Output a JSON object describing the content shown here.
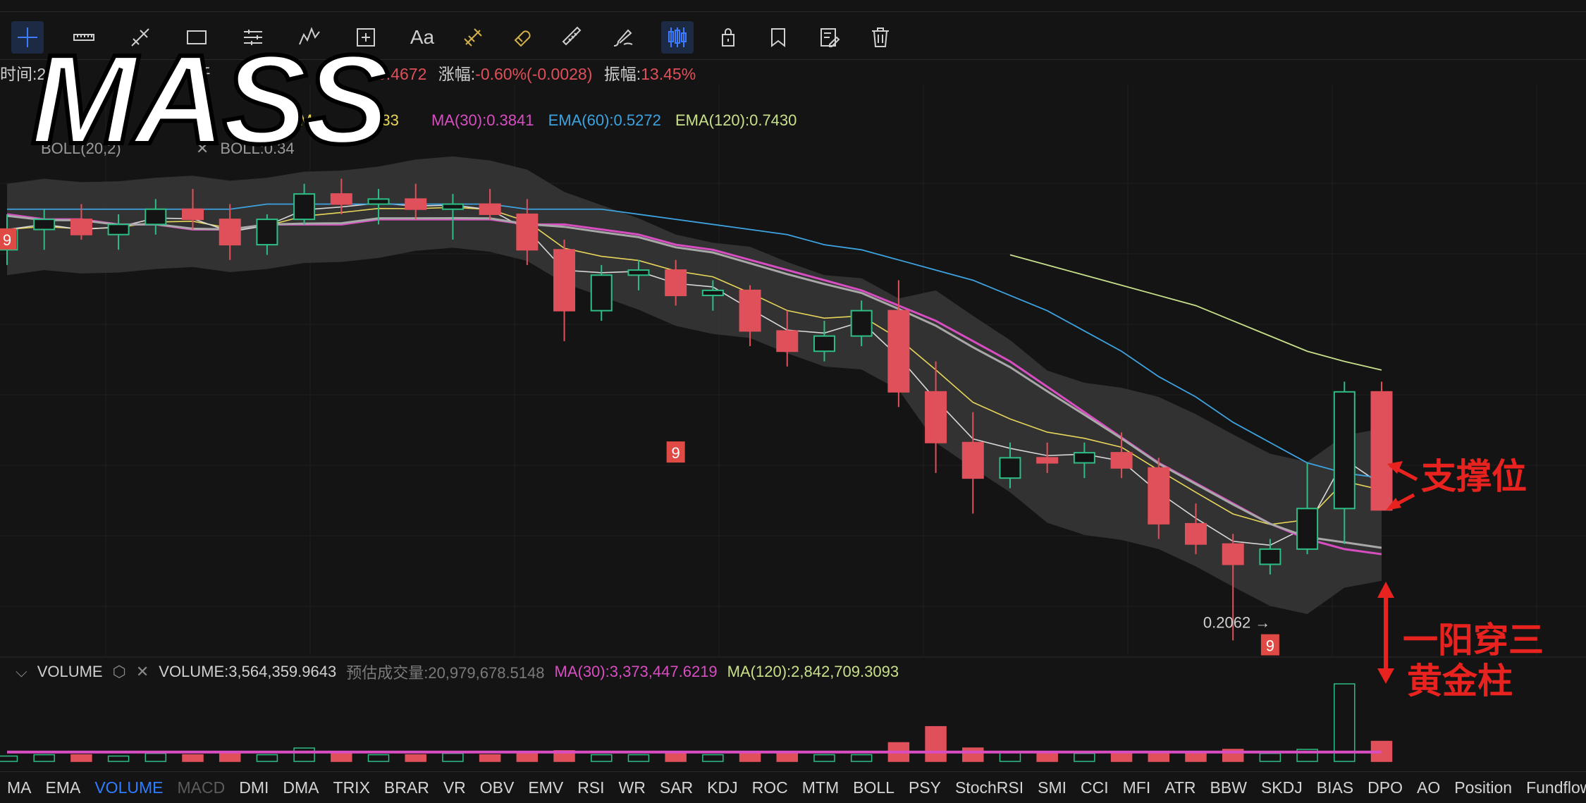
{
  "toolbar": {
    "tools": [
      "crosshair-icon",
      "ruler-icon",
      "trend-line-icon",
      "rectangle-icon",
      "parallel-lines-icon",
      "wave-pattern-icon",
      "add-indicator-icon",
      "text-tool",
      "measure-icon",
      "magnet-icon",
      "ruler-pen-icon",
      "brush-icon",
      "candlestick-icon",
      "lock-icon",
      "bookmark-icon",
      "edit-note-icon",
      "trash-icon"
    ],
    "text_tool_label": "Aa"
  },
  "info": {
    "time_label": "时间:",
    "time_value": "25-1",
    "time_suffix": "0",
    "open_label": "开",
    "close_value": "0.4672",
    "change_label": "涨幅:",
    "change_value": "-0.60%(-0.0028)",
    "amp_label": "振幅:",
    "amp_value": "13.45%"
  },
  "ma_labels": {
    "ema_partial": "EM",
    "ema_partial_value": "833",
    "ma30": "MA(30):0.3841",
    "ema60": "EMA(60):0.5272",
    "ema120": "EMA(120):0.7430"
  },
  "boll": {
    "label": "BOLL(20,2)",
    "value": "BOLL:0.34"
  },
  "overlay": {
    "title": "MASS"
  },
  "annotations": {
    "support": "支撑位",
    "golden_line1": "一阳穿三",
    "golden_line2": "黄金柱"
  },
  "markers": {
    "nine": "9",
    "low_price": "0.2062 →"
  },
  "volume": {
    "title": "VOLUME",
    "value": "VOLUME:3,564,359.9643",
    "est": "预估成交量:20,979,678.5148",
    "ma30": "MA(30):3,373,447.6219",
    "ma120": "MA(120):2,842,709.3093"
  },
  "indicator_tabs": [
    "MA",
    "EMA",
    "VOLUME",
    "MACD",
    "DMI",
    "DMA",
    "TRIX",
    "BRAR",
    "VR",
    "OBV",
    "EMV",
    "RSI",
    "WR",
    "SAR",
    "KDJ",
    "ROC",
    "MTM",
    "BOLL",
    "PSY",
    "StochRSI",
    "SMI",
    "CCI",
    "MFI",
    "ATR",
    "BBW",
    "SKDJ",
    "BIAS",
    "DPO",
    "AO",
    "Position",
    "Fundflow"
  ],
  "active_tab": "VOLUME",
  "disabled_tab": "MACD",
  "colors": {
    "up": "#2ebd85",
    "down": "#e0505a",
    "ema_short": "#d8d8d8",
    "ema_mid": "#e8d65a",
    "ma30": "#d84ec2",
    "ema60": "#3da3e0",
    "ema120": "#c8e08a",
    "boll_band": "#3a3a3a",
    "annotation": "#e8231f"
  },
  "chart_data": {
    "type": "candlestick",
    "title": "",
    "price_range": [
      0.18,
      1.25
    ],
    "series": [
      {
        "name": "MA(30)",
        "values": [
          1.05,
          1.04,
          1.04,
          1.03,
          1.03,
          1.02,
          1.02,
          1.03,
          1.03,
          1.03,
          1.04,
          1.04,
          1.04,
          1.04,
          1.03,
          1.03,
          1.02,
          1.01,
          0.99,
          0.98,
          0.96,
          0.94,
          0.92,
          0.9,
          0.87,
          0.84,
          0.8,
          0.76,
          0.71,
          0.66,
          0.61,
          0.56,
          0.52,
          0.48,
          0.44,
          0.41,
          0.39,
          0.38
        ]
      },
      {
        "name": "EMA(60)",
        "values": [
          1.06,
          1.06,
          1.06,
          1.06,
          1.06,
          1.06,
          1.06,
          1.07,
          1.07,
          1.07,
          1.07,
          1.07,
          1.07,
          1.07,
          1.06,
          1.06,
          1.06,
          1.05,
          1.04,
          1.03,
          1.02,
          1.01,
          0.99,
          0.98,
          0.96,
          0.94,
          0.92,
          0.89,
          0.86,
          0.82,
          0.78,
          0.73,
          0.69,
          0.64,
          0.6,
          0.56,
          0.54,
          0.53
        ]
      },
      {
        "name": "EMA(120)",
        "values": [
          null,
          null,
          null,
          null,
          null,
          null,
          null,
          null,
          null,
          null,
          null,
          null,
          null,
          null,
          null,
          null,
          null,
          null,
          null,
          null,
          null,
          null,
          null,
          null,
          null,
          null,
          null,
          0.97,
          0.95,
          0.93,
          0.91,
          0.89,
          0.87,
          0.84,
          0.81,
          0.78,
          0.76,
          0.743
        ]
      }
    ],
    "candles": [
      {
        "o": 0.98,
        "h": 1.05,
        "l": 0.95,
        "c": 1.02
      },
      {
        "o": 1.02,
        "h": 1.06,
        "l": 0.98,
        "c": 1.04
      },
      {
        "o": 1.04,
        "h": 1.07,
        "l": 1.0,
        "c": 1.01
      },
      {
        "o": 1.01,
        "h": 1.05,
        "l": 0.98,
        "c": 1.03
      },
      {
        "o": 1.03,
        "h": 1.08,
        "l": 1.01,
        "c": 1.06
      },
      {
        "o": 1.06,
        "h": 1.1,
        "l": 1.02,
        "c": 1.04
      },
      {
        "o": 1.04,
        "h": 1.07,
        "l": 0.96,
        "c": 0.99
      },
      {
        "o": 0.99,
        "h": 1.05,
        "l": 0.97,
        "c": 1.04
      },
      {
        "o": 1.04,
        "h": 1.11,
        "l": 1.03,
        "c": 1.09
      },
      {
        "o": 1.09,
        "h": 1.12,
        "l": 1.05,
        "c": 1.07
      },
      {
        "o": 1.07,
        "h": 1.1,
        "l": 1.03,
        "c": 1.08
      },
      {
        "o": 1.08,
        "h": 1.11,
        "l": 1.04,
        "c": 1.06
      },
      {
        "o": 1.06,
        "h": 1.09,
        "l": 1.0,
        "c": 1.07
      },
      {
        "o": 1.07,
        "h": 1.1,
        "l": 1.04,
        "c": 1.05
      },
      {
        "o": 1.05,
        "h": 1.08,
        "l": 0.95,
        "c": 0.98
      },
      {
        "o": 0.98,
        "h": 1.0,
        "l": 0.8,
        "c": 0.86
      },
      {
        "o": 0.86,
        "h": 0.95,
        "l": 0.84,
        "c": 0.93
      },
      {
        "o": 0.93,
        "h": 0.96,
        "l": 0.9,
        "c": 0.94
      },
      {
        "o": 0.94,
        "h": 0.96,
        "l": 0.87,
        "c": 0.89
      },
      {
        "o": 0.89,
        "h": 0.92,
        "l": 0.86,
        "c": 0.9
      },
      {
        "o": 0.9,
        "h": 0.91,
        "l": 0.79,
        "c": 0.82
      },
      {
        "o": 0.82,
        "h": 0.86,
        "l": 0.75,
        "c": 0.78
      },
      {
        "o": 0.78,
        "h": 0.84,
        "l": 0.76,
        "c": 0.81
      },
      {
        "o": 0.81,
        "h": 0.88,
        "l": 0.79,
        "c": 0.86
      },
      {
        "o": 0.86,
        "h": 0.92,
        "l": 0.67,
        "c": 0.7
      },
      {
        "o": 0.7,
        "h": 0.76,
        "l": 0.54,
        "c": 0.6
      },
      {
        "o": 0.6,
        "h": 0.66,
        "l": 0.46,
        "c": 0.53
      },
      {
        "o": 0.53,
        "h": 0.6,
        "l": 0.51,
        "c": 0.57
      },
      {
        "o": 0.57,
        "h": 0.6,
        "l": 0.54,
        "c": 0.56
      },
      {
        "o": 0.56,
        "h": 0.6,
        "l": 0.53,
        "c": 0.58
      },
      {
        "o": 0.58,
        "h": 0.62,
        "l": 0.53,
        "c": 0.55
      },
      {
        "o": 0.55,
        "h": 0.57,
        "l": 0.41,
        "c": 0.44
      },
      {
        "o": 0.44,
        "h": 0.48,
        "l": 0.38,
        "c": 0.4
      },
      {
        "o": 0.4,
        "h": 0.42,
        "l": 0.21,
        "c": 0.36
      },
      {
        "o": 0.36,
        "h": 0.41,
        "l": 0.34,
        "c": 0.39
      },
      {
        "o": 0.39,
        "h": 0.56,
        "l": 0.38,
        "c": 0.47
      },
      {
        "o": 0.47,
        "h": 0.72,
        "l": 0.4,
        "c": 0.7
      },
      {
        "o": 0.7,
        "h": 0.72,
        "l": 0.6,
        "c": 0.4672
      }
    ],
    "volume_values": [
      0.4,
      0.5,
      0.5,
      0.4,
      0.6,
      0.5,
      0.7,
      0.5,
      1.0,
      0.6,
      0.5,
      0.5,
      0.6,
      0.5,
      0.6,
      0.8,
      0.5,
      0.5,
      0.6,
      0.5,
      0.6,
      0.7,
      0.5,
      0.5,
      1.4,
      2.6,
      1.0,
      0.7,
      0.6,
      0.6,
      0.6,
      0.7,
      0.6,
      0.9,
      0.6,
      0.9,
      5.8,
      1.5
    ]
  }
}
